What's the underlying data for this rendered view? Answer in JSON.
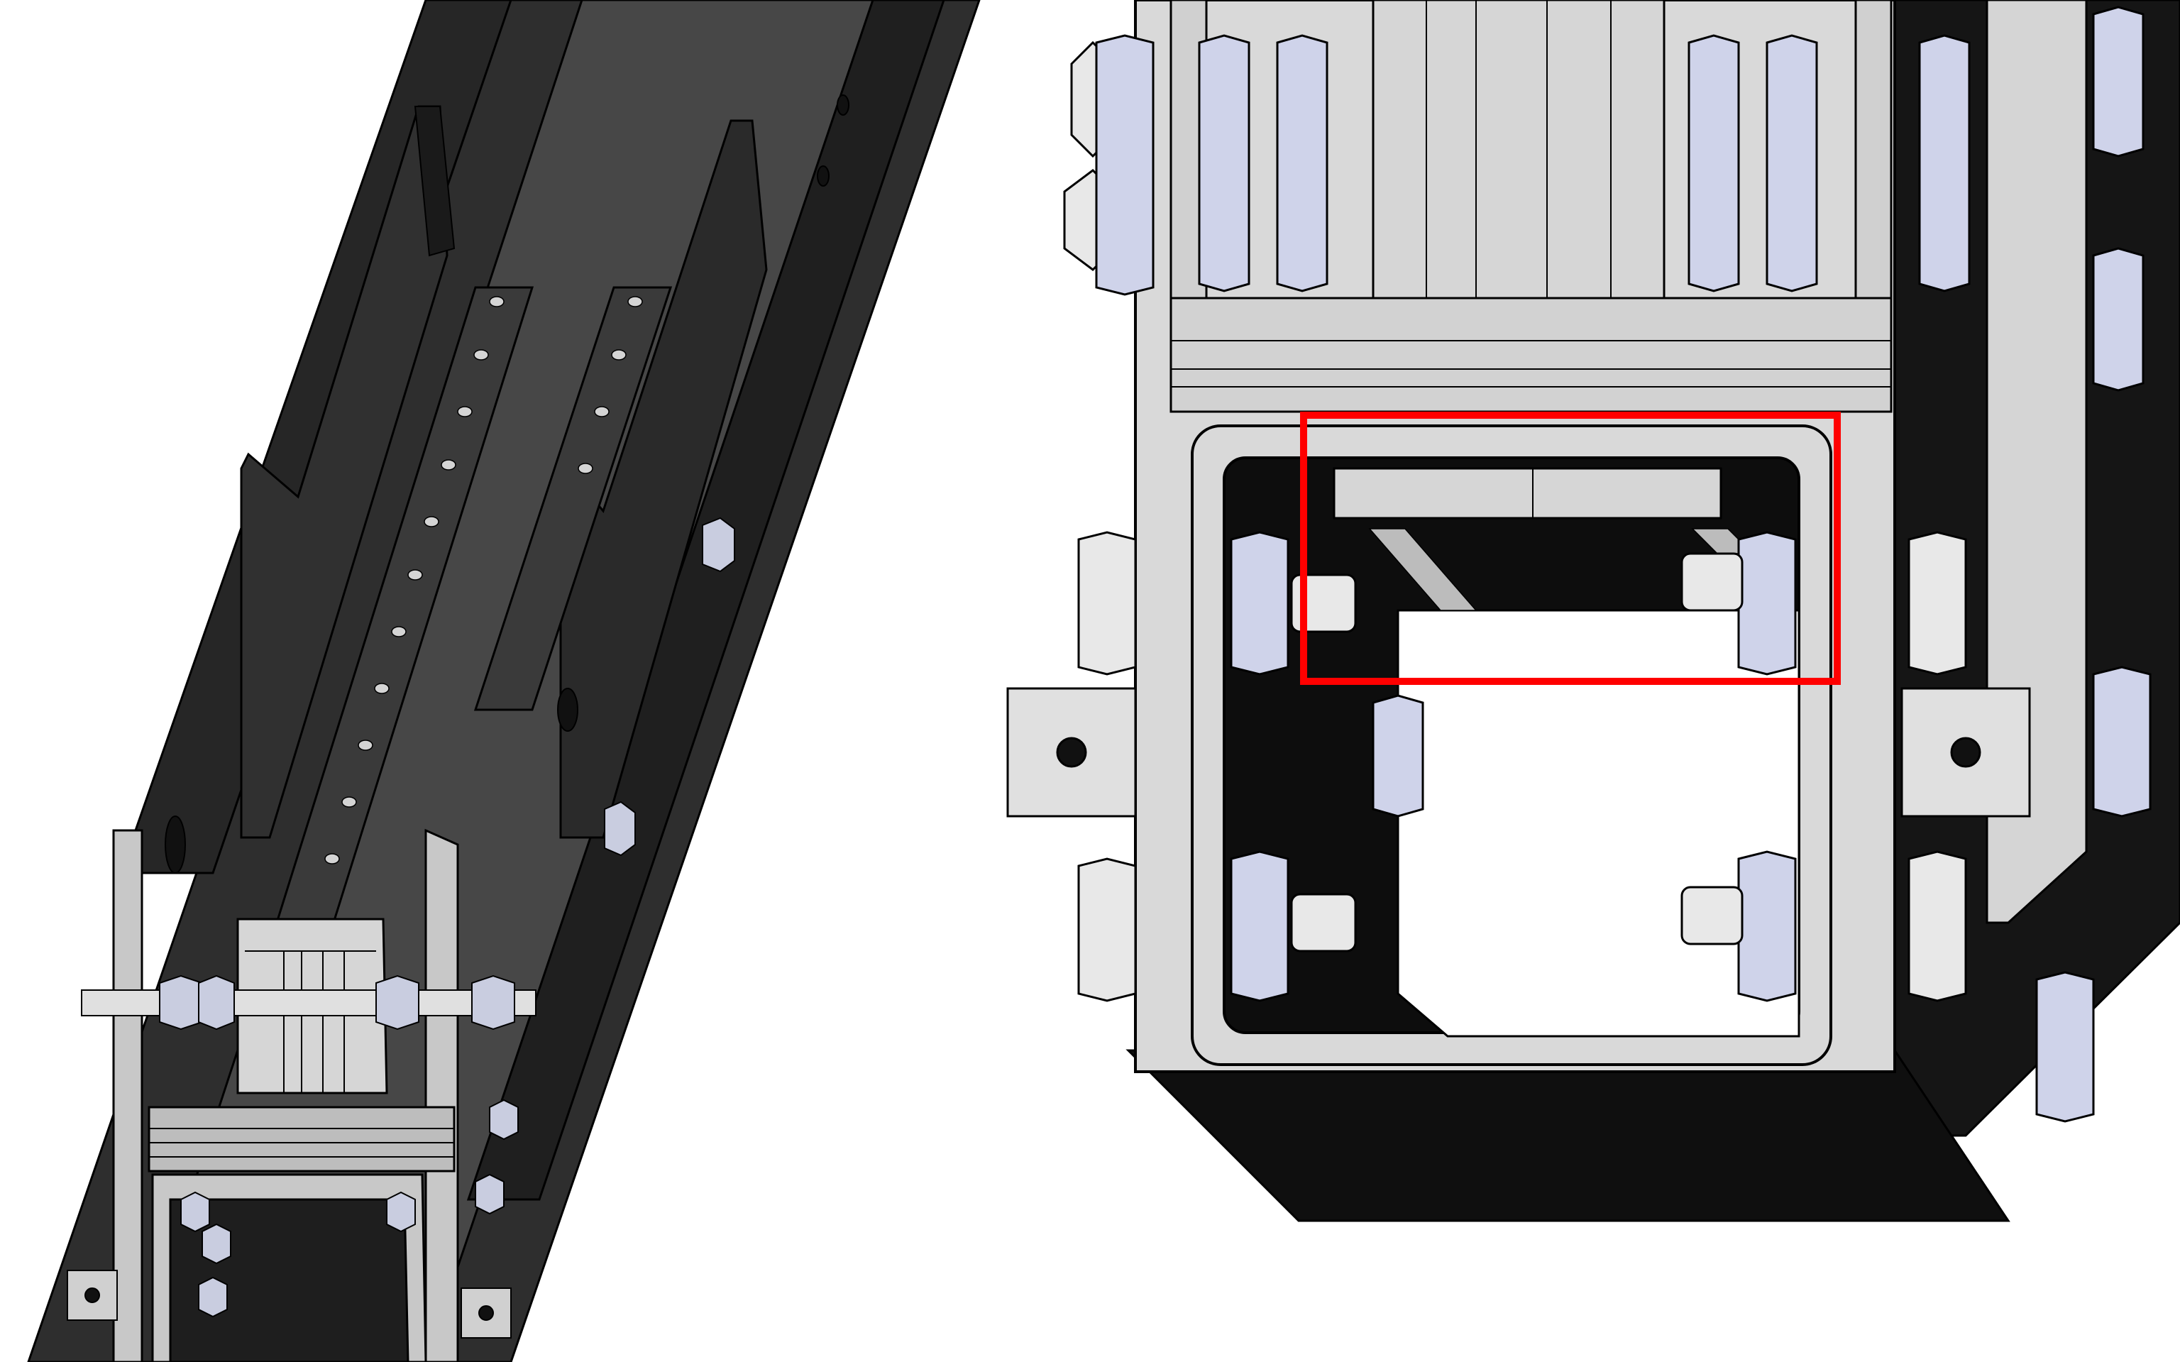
{
  "figure": {
    "left_view": {
      "description_label": "",
      "colors": {
        "rail_dark": "#2b2b2b",
        "rail_mid": "#3d3d3d",
        "rail_light": "#4a4a4a",
        "plate_grey": "#c8c8c8",
        "nut_blue": "#c9cde0",
        "edge": "#000000"
      }
    },
    "right_view": {
      "colors": {
        "bracket": "#d9d9d9",
        "bracket_shadow": "#bdbdbd",
        "cavity": "#0d0d0d",
        "nut_blue": "#cfd3ea",
        "nut_grey": "#a0a0a6",
        "bolt": "#e8e8e8",
        "highlight": "#ff0000"
      },
      "highlight_box_label": ""
    }
  }
}
